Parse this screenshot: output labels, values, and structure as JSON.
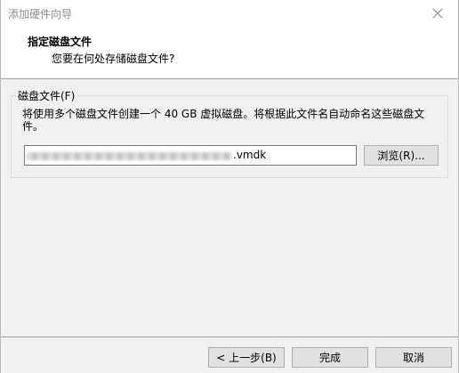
{
  "window": {
    "title": "添加硬件向导"
  },
  "header": {
    "title": "指定磁盘文件",
    "subtitle": "您要在何处存储磁盘文件?"
  },
  "disk_file_group": {
    "label": "磁盘文件(F)",
    "description": "将使用多个磁盘文件创建一个 40 GB 虚拟磁盘。将根据此文件名自动命名这些磁盘文件。",
    "path_visible_suffix": ".vmdk",
    "browse_label": "浏览(R)..."
  },
  "footer": {
    "back_label": "< 上一步(B)",
    "finish_label": "完成",
    "cancel_label": "取消"
  }
}
